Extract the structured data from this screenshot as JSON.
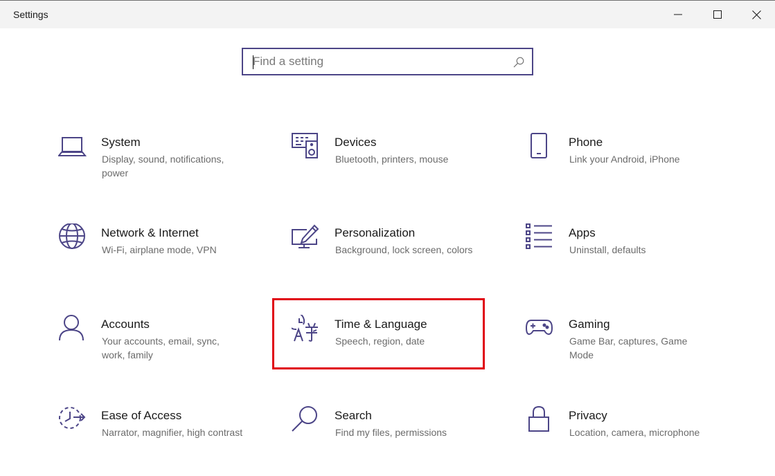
{
  "window": {
    "title": "Settings",
    "controls": {
      "minimize": "minimize-icon",
      "maximize": "maximize-icon",
      "close": "close-icon"
    }
  },
  "search": {
    "placeholder": "Find a setting",
    "value": ""
  },
  "accent_color": "#4c4587",
  "highlight_color": "#e0000f",
  "tiles": [
    {
      "name": "System",
      "desc": "Display, sound, notifications, power",
      "icon": "laptop-icon"
    },
    {
      "name": "Devices",
      "desc": "Bluetooth, printers, mouse",
      "icon": "keyboard-speaker-icon"
    },
    {
      "name": "Phone",
      "desc": "Link your Android, iPhone",
      "icon": "phone-icon"
    },
    {
      "name": "Network & Internet",
      "desc": "Wi-Fi, airplane mode, VPN",
      "icon": "globe-icon"
    },
    {
      "name": "Personalization",
      "desc": "Background, lock screen, colors",
      "icon": "paint-monitor-icon"
    },
    {
      "name": "Apps",
      "desc": "Uninstall, defaults",
      "icon": "app-list-icon"
    },
    {
      "name": "Accounts",
      "desc": "Your accounts, email, sync, work, family",
      "icon": "person-icon"
    },
    {
      "name": "Time & Language",
      "desc": "Speech, region, date",
      "icon": "time-language-icon",
      "highlighted": true
    },
    {
      "name": "Gaming",
      "desc": "Game Bar, captures, Game Mode",
      "icon": "gamepad-icon"
    },
    {
      "name": "Ease of Access",
      "desc": "Narrator, magnifier, high contrast",
      "icon": "ease-of-access-icon"
    },
    {
      "name": "Search",
      "desc": "Find my files, permissions",
      "icon": "magnifier-icon"
    },
    {
      "name": "Privacy",
      "desc": "Location, camera, microphone",
      "icon": "lock-icon"
    }
  ]
}
